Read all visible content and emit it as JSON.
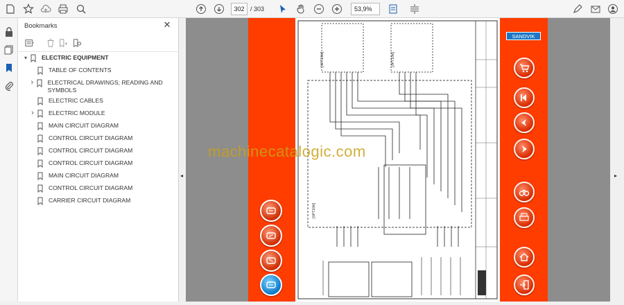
{
  "toolbar": {
    "current_page": "302",
    "page_of": "/ 303",
    "zoom": "53,9%"
  },
  "bookmarks": {
    "title": "Bookmarks",
    "items": [
      {
        "label": "ELECTRIC EQUIPMENT",
        "level": 0,
        "expanded": true
      },
      {
        "label": "TABLE OF CONTENTS",
        "level": 1
      },
      {
        "label": "ELECTRICAL DRAWINGS; READING AND SYMBOLS",
        "level": 1,
        "has_children": true
      },
      {
        "label": "ELECTRIC CABLES",
        "level": 1
      },
      {
        "label": "ELECTRIC MODULE",
        "level": 1,
        "has_children": true
      },
      {
        "label": "MAIN CIRCUIT DIAGRAM",
        "level": 1
      },
      {
        "label": "CONTROL CIRCUIT DIAGRAM",
        "level": 1
      },
      {
        "label": "CONTROL CIRCUIT DIAGRAM",
        "level": 1
      },
      {
        "label": "CONTROL CIRCUIT DIAGRAM",
        "level": 1
      },
      {
        "label": "MAIN CIRCUIT DIAGRAM",
        "level": 1
      },
      {
        "label": "CONTROL CIRCUIT DIAGRAM",
        "level": 1
      },
      {
        "label": "CARRIER CIRCUIT DIAGRAM",
        "level": 1
      }
    ]
  },
  "document": {
    "brand": "SANDVIK",
    "watermark": "machinecatalogic.com",
    "option_label": "(OPTION)",
    "accent_color": "#ff3d00"
  }
}
